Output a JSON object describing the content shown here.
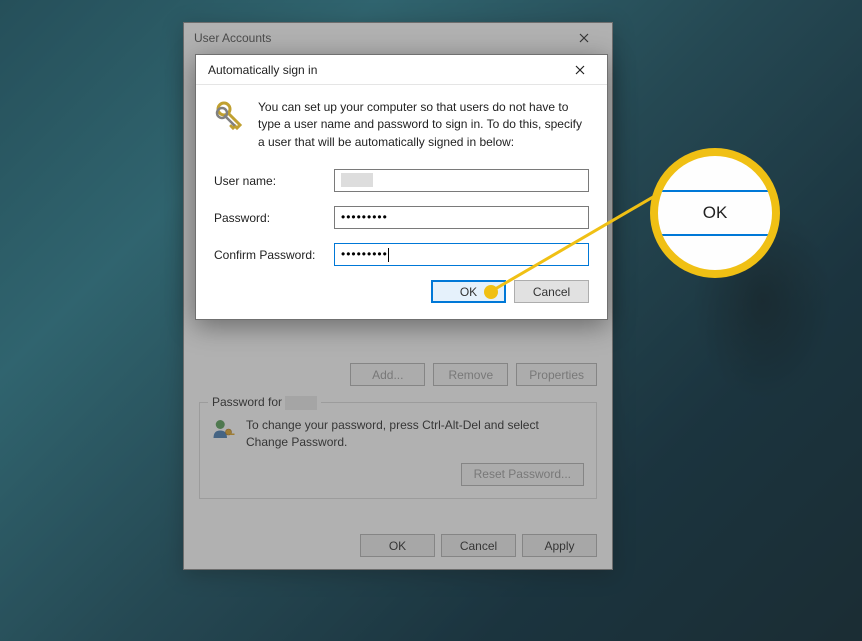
{
  "parent_window": {
    "title": "User Accounts",
    "buttons": {
      "add": "Add...",
      "remove": "Remove",
      "properties": "Properties"
    },
    "password_group": {
      "label_prefix": "Password for",
      "text": "To change your password, press Ctrl-Alt-Del and select Change Password.",
      "reset_button": "Reset Password..."
    },
    "footer": {
      "ok": "OK",
      "cancel": "Cancel",
      "apply": "Apply"
    }
  },
  "modal": {
    "title": "Automatically sign in",
    "info": "You can set up your computer so that users do not have to type a user name and password to sign in. To do this, specify a user that will be automatically signed in below:",
    "fields": {
      "username_label": "User name:",
      "username_value": "",
      "password_label": "Password:",
      "password_value": "•••••••••",
      "confirm_label": "Confirm Password:",
      "confirm_value": "•••••••••"
    },
    "buttons": {
      "ok": "OK",
      "cancel": "Cancel"
    }
  },
  "callout": {
    "label": "OK"
  }
}
